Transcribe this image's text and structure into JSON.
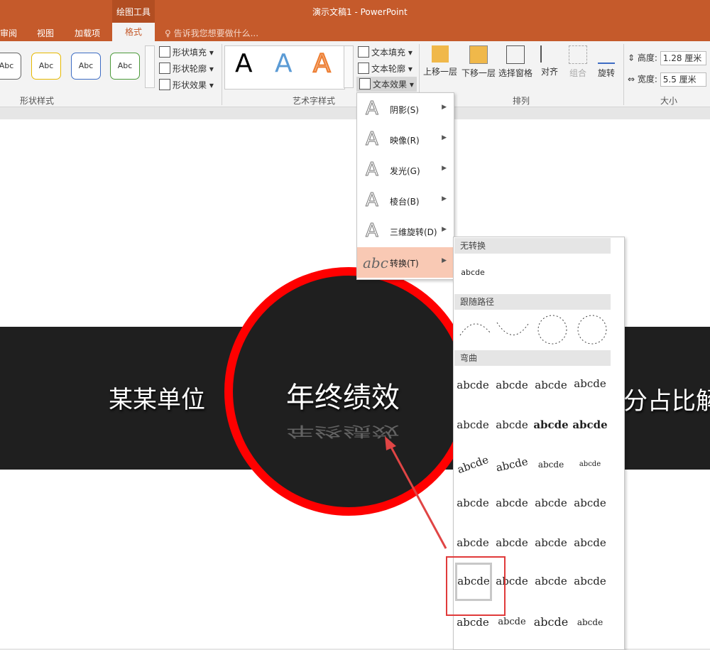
{
  "titlebar": {
    "context_group": "绘图工具",
    "doc_title": "演示文稿1 - PowerPoint"
  },
  "tabs": {
    "review": "审阅",
    "view": "视图",
    "addins": "加载项",
    "format": "格式",
    "tellme": "告诉我您想要做什么..."
  },
  "ribbon": {
    "shape_styles": {
      "presets": [
        "Abc",
        "Abc",
        "Abc",
        "Abc"
      ],
      "fill": "形状填充",
      "outline": "形状轮廓",
      "effects": "形状效果",
      "group_label": "形状样式"
    },
    "wordart": {
      "letter": "A",
      "fill": "文本填充",
      "outline": "文本轮廓",
      "effects": "文本效果",
      "group_label": "艺术字样式"
    },
    "arrange": {
      "bring_forward": "上移一层",
      "send_backward": "下移一层",
      "selection_pane": "选择窗格",
      "align": "对齐",
      "group": "组合",
      "rotate": "旋转",
      "group_label": "排列"
    },
    "size": {
      "height_label": "高度:",
      "height_value": "1.28 厘米",
      "width_label": "宽度:",
      "width_value": "5.5 厘米",
      "group_label": "大小"
    }
  },
  "slide": {
    "left_text": "某某单位",
    "center_text": "年终绩效",
    "right_text": "分占比解"
  },
  "text_effects_menu": {
    "items": [
      {
        "label": "阴影(S)"
      },
      {
        "label": "映像(R)"
      },
      {
        "label": "发光(G)"
      },
      {
        "label": "棱台(B)"
      },
      {
        "label": "三维旋转(D)"
      },
      {
        "label": "转换(T)"
      }
    ],
    "transform_icon_text": "abc"
  },
  "transform_gallery": {
    "no_transform_header": "无转换",
    "no_transform_item": "abcde",
    "follow_path_header": "跟随路径",
    "warp_header": "弯曲",
    "warp_items": [
      "abcde",
      "abcde",
      "abcde",
      "abcde",
      "abcde",
      "abcde",
      "abcde",
      "abcde",
      "abcde",
      "abcde",
      "abcde",
      "abcde",
      "abcde",
      "abcde",
      "abcde",
      "abcde",
      "abcde",
      "abcde",
      "abcde",
      "abcde",
      "abcde",
      "abcde",
      "abcde",
      "abcde",
      "abcde",
      "abcde",
      "abcde",
      "abcde"
    ]
  },
  "colors": {
    "accent": "#c55a2b",
    "highlight_red": "#e03a3a",
    "circle_red": "#ff0000",
    "band": "#1f1f1f",
    "menu_active": "#f9c9b4"
  }
}
